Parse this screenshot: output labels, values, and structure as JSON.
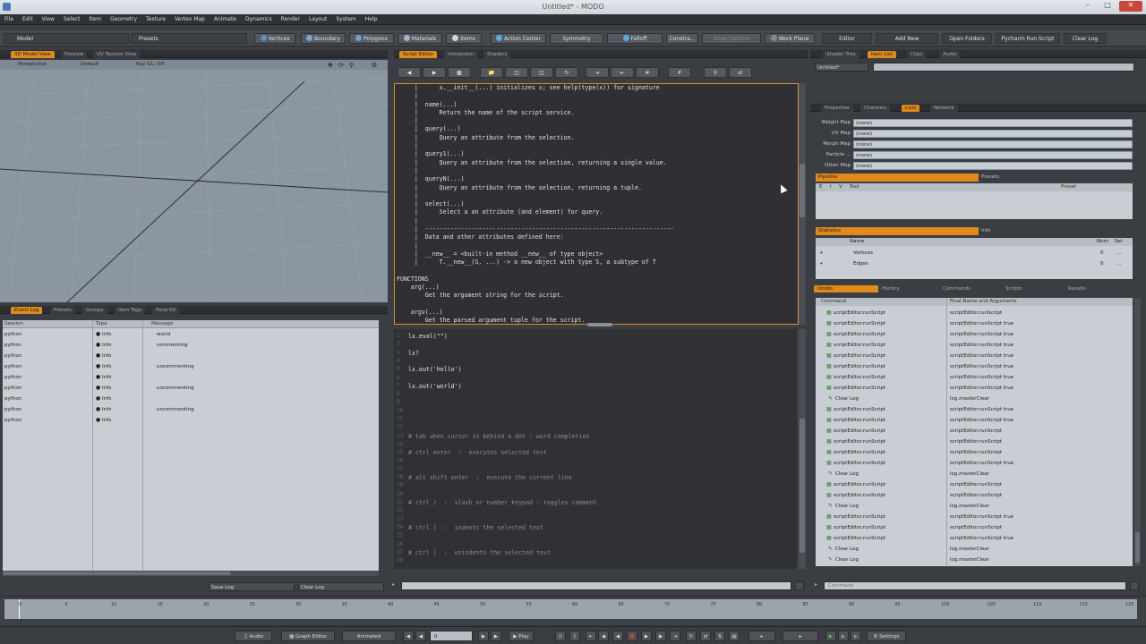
{
  "window": {
    "title": "Untitled* - MODO"
  },
  "menu": [
    "File",
    "Edit",
    "View",
    "Select",
    "Item",
    "Geometry",
    "Texture",
    "Vertex Map",
    "Animate",
    "Dynamics",
    "Render",
    "Layout",
    "System",
    "Help"
  ],
  "toolbar": {
    "model": "Model",
    "presets": "Presets",
    "vertices": "Vertices",
    "boundary": "Boundary",
    "polygons": "Polygons",
    "materials": "Materials",
    "items": "Items",
    "action_center": "Action Center",
    "symmetry": "Symmetry",
    "falloff": "Falloff",
    "constrain": "Constra...",
    "snapping": "Snap Options",
    "work_plane": "Work Plane",
    "editor": "Editor",
    "add_new": "Add New",
    "open_folders": "Open Folders",
    "pycharm": "Pycharm Run Script",
    "clear_log": "Clear Log"
  },
  "viewport": {
    "tabs": [
      "3D Model View",
      "Preview",
      "UV Texture View"
    ],
    "perspective": "Perspective",
    "default": "Default",
    "ray_gl": "Ray GL: Off"
  },
  "eventlog": {
    "tabs": [
      "Event Log",
      "Presets",
      "Groups",
      "Item Tags",
      "Pane Kit"
    ],
    "headers": [
      "Session",
      "Type",
      "Message"
    ],
    "rows": [
      {
        "session": "python",
        "type": "Info",
        "message": "world"
      },
      {
        "session": "python",
        "type": "Info",
        "message": "commenting"
      },
      {
        "session": "python",
        "type": "Info",
        "message": ""
      },
      {
        "session": "python",
        "type": "Info",
        "message": "uncommenting"
      },
      {
        "session": "python",
        "type": "Info",
        "message": ""
      },
      {
        "session": "python",
        "type": "Info",
        "message": "uncommenting"
      },
      {
        "session": "python",
        "type": "Info",
        "message": ""
      },
      {
        "session": "python",
        "type": "Info",
        "message": "uncommenting"
      },
      {
        "session": "python",
        "type": "Info",
        "message": ""
      }
    ],
    "save_log": "Save Log",
    "clear_log": "Clear Log"
  },
  "script_editor": {
    "tabs": [
      "Script Editor",
      "Interpreter",
      "Shaders"
    ],
    "doc_text": "     |      x.__init__(...) initializes x; see help(type(x)) for signature\n     |\n     |  name(...)\n     |      Return the name of the script service.\n     |\n     |  query(...)\n     |      Query an attribute from the selection.\n     |\n     |  query1(...)\n     |      Query an attribute from the selection, returning a single value.\n     |\n     |  queryN(...)\n     |      Query an attribute from the selection, returning a tuple.\n     |\n     |  select(...)\n     |      Select a an attribute (and element) for query.\n     |\n     |  ----------------------------------------------------------------------\n     |  Data and other attributes defined here:\n     |\n     |  __new__ = <built-in method __new__ of type object>\n     |      T.__new__(S, ...) -> a new object with type S, a subtype of T\n\nFUNCTIONS\n    arg(...)\n        Get the argument string for the script.\n\n    argv(...)\n        Get the parsed argument tuple for the script.",
    "lines": [
      {
        "n": "1",
        "code": "lx.eval(\"\")",
        "cm": false
      },
      {
        "n": "2",
        "code": "",
        "cm": false
      },
      {
        "n": "3",
        "code": "lx?",
        "cm": false
      },
      {
        "n": "4",
        "code": "",
        "cm": false
      },
      {
        "n": "5",
        "code": "lx.out('hello')",
        "cm": false
      },
      {
        "n": "6",
        "code": "",
        "cm": false
      },
      {
        "n": "7",
        "code": "lx.out('world')",
        "cm": false
      },
      {
        "n": "8",
        "code": "",
        "cm": false
      },
      {
        "n": "9",
        "code": "",
        "cm": false
      },
      {
        "n": "10",
        "code": "",
        "cm": false
      },
      {
        "n": "11",
        "code": "",
        "cm": false
      },
      {
        "n": "12",
        "code": "",
        "cm": false
      },
      {
        "n": "13",
        "code": "# tab when cursor is behind a dot : word completion",
        "cm": true
      },
      {
        "n": "14",
        "code": "",
        "cm": false
      },
      {
        "n": "15",
        "code": "# ctrl enter  :  executes selected text",
        "cm": true
      },
      {
        "n": "16",
        "code": "",
        "cm": false
      },
      {
        "n": "17",
        "code": "",
        "cm": false
      },
      {
        "n": "18",
        "code": "# alt shift enter  :  execute the current line",
        "cm": true
      },
      {
        "n": "19",
        "code": "",
        "cm": false
      },
      {
        "n": "20",
        "code": "",
        "cm": false
      },
      {
        "n": "21",
        "code": "# ctrl /  :  slash or number keypad : toggles comment",
        "cm": true
      },
      {
        "n": "22",
        "code": "",
        "cm": false
      },
      {
        "n": "23",
        "code": "",
        "cm": false
      },
      {
        "n": "24",
        "code": "# ctrl ]  :  indents the selected text",
        "cm": true
      },
      {
        "n": "25",
        "code": "",
        "cm": false
      },
      {
        "n": "26",
        "code": "",
        "cm": false
      },
      {
        "n": "27",
        "code": "# ctrl [  :  unindents the selected text",
        "cm": true
      },
      {
        "n": "28",
        "code": "",
        "cm": false
      }
    ]
  },
  "right": {
    "top_tabs": [
      "Shader Tree",
      "Item List",
      "Clips",
      "Audio"
    ],
    "item_dropdown": "Untitled*",
    "mid_tabs": [
      "Properties",
      "Channels",
      "Lists",
      "Network"
    ],
    "maps": [
      {
        "label": "Weight Map",
        "value": "(none)"
      },
      {
        "label": "UV Map",
        "value": "(none)"
      },
      {
        "label": "Morph Map",
        "value": "(none)"
      },
      {
        "label": "Particle ...",
        "value": "(none)"
      },
      {
        "label": "Other Map",
        "value": "(none)"
      }
    ],
    "pipeline": {
      "title": "Pipeline",
      "presets": "Presets",
      "cols": [
        "E",
        "I",
        "V",
        "Tool",
        "Preset"
      ]
    },
    "statistics": {
      "title": "Statistics",
      "info": "Info",
      "cols": [
        "Name",
        "Num",
        "Sel"
      ],
      "rows": [
        {
          "name": "Vertices",
          "num": "0",
          "sel": "..."
        },
        {
          "name": "Edges",
          "num": "0",
          "sel": "..."
        }
      ]
    },
    "undo_tabs": [
      "Undos",
      "History",
      "Commands",
      "Scripts",
      "Results"
    ],
    "undo_cols": [
      "Command",
      "Final Name and Arguments"
    ],
    "undo_rows": [
      {
        "c": "scriptEditor.runScript",
        "a": "scriptEditor.runScript"
      },
      {
        "c": "scriptEditor.runScript",
        "a": "scriptEditor.runScript true"
      },
      {
        "c": "scriptEditor.runScript",
        "a": "scriptEditor.runScript true"
      },
      {
        "c": "scriptEditor.runScript",
        "a": "scriptEditor.runScript true"
      },
      {
        "c": "scriptEditor.runScript",
        "a": "scriptEditor.runScript true"
      },
      {
        "c": "scriptEditor.runScript",
        "a": "scriptEditor.runScript true"
      },
      {
        "c": "scriptEditor.runScript",
        "a": "scriptEditor.runScript true"
      },
      {
        "c": "scriptEditor.runScript",
        "a": "scriptEditor.runScript true"
      },
      {
        "c": "Clear Log",
        "a": "log.masterClear"
      },
      {
        "c": "scriptEditor.runScript",
        "a": "scriptEditor.runScript true"
      },
      {
        "c": "scriptEditor.runScript",
        "a": "scriptEditor.runScript true"
      },
      {
        "c": "scriptEditor.runScript",
        "a": "scriptEditor.runScript"
      },
      {
        "c": "scriptEditor.runScript",
        "a": "scriptEditor.runScript"
      },
      {
        "c": "scriptEditor.runScript",
        "a": "scriptEditor.runScript"
      },
      {
        "c": "scriptEditor.runScript",
        "a": "scriptEditor.runScript true"
      },
      {
        "c": "Clear Log",
        "a": "log.masterClear"
      },
      {
        "c": "scriptEditor.runScript",
        "a": "scriptEditor.runScript"
      },
      {
        "c": "scriptEditor.runScript",
        "a": "scriptEditor.runScript"
      },
      {
        "c": "Clear Log",
        "a": "log.masterClear"
      },
      {
        "c": "scriptEditor.runScript",
        "a": "scriptEditor.runScript true"
      },
      {
        "c": "scriptEditor.runScript",
        "a": "scriptEditor.runScript"
      },
      {
        "c": "scriptEditor.runScript",
        "a": "scriptEditor.runScript true"
      },
      {
        "c": "Clear Log",
        "a": "log.masterClear"
      },
      {
        "c": "Clear Log",
        "a": "log.masterClear"
      }
    ],
    "command_placeholder": "Command"
  },
  "timeline": {
    "ticks": [
      "0",
      "5",
      "10",
      "15",
      "20",
      "25",
      "30",
      "35",
      "40",
      "45",
      "50",
      "55",
      "60",
      "65",
      "70",
      "75",
      "80",
      "85",
      "90",
      "95",
      "100",
      "105",
      "110",
      "115",
      "120"
    ]
  },
  "bottom": {
    "audio": "Audio",
    "graph_editor": "Graph Editor",
    "animated": "Animated",
    "frame": "0",
    "play": "Play",
    "settings": "Settings"
  }
}
